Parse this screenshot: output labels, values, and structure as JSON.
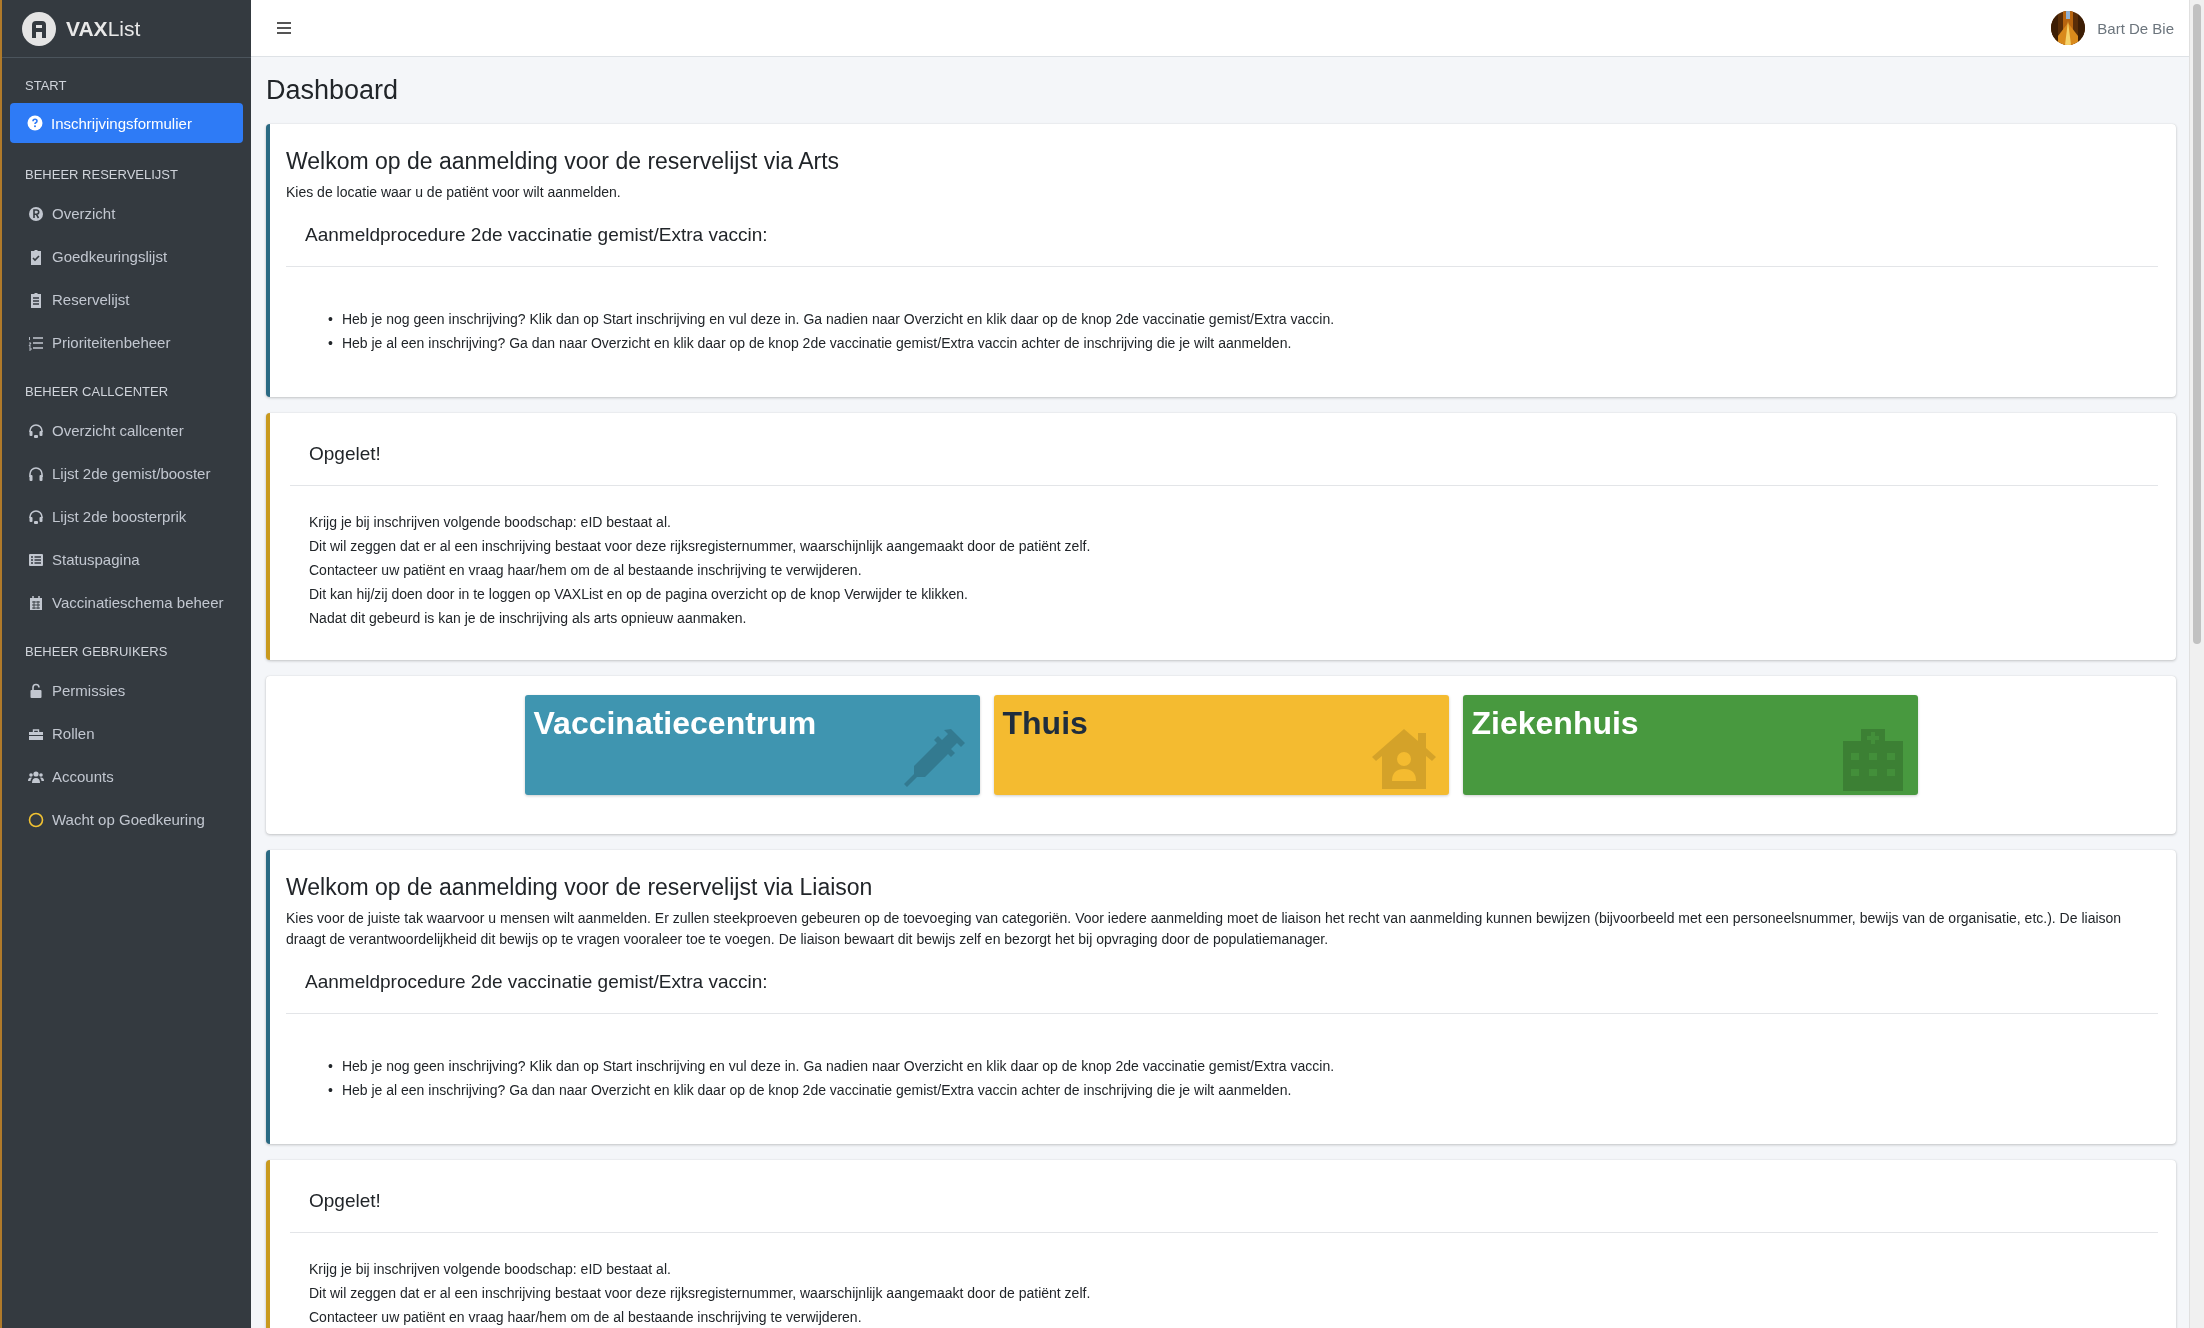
{
  "sidebar": {
    "brand": "**VAX**List",
    "sections": [
      {
        "header": "START",
        "items": [
          {
            "label": "Inschrijvingsformulier",
            "selected": true
          }
        ]
      },
      {
        "header": "BEHEER RESERVELIJST",
        "items": [
          {
            "label": "Overzicht",
            "selected": false
          },
          {
            "label": "Goedkeuringslijst",
            "selected": false
          },
          {
            "label": "Reservelijst",
            "selected": false
          },
          {
            "label": "Prioriteitenbeheer",
            "selected": false
          }
        ]
      },
      {
        "header": "BEHEER CALLCENTER",
        "items": [
          {
            "label": "Overzicht callcenter",
            "selected": false
          },
          {
            "label": "Lijst 2de gemist/booster",
            "selected": false
          },
          {
            "label": "Lijst 2de boosterprik",
            "selected": false
          },
          {
            "label": "Statuspagina",
            "selected": false
          },
          {
            "label": "Vaccinatieschema beheer",
            "selected": false
          }
        ]
      },
      {
        "header": "BEHEER GEBRUIKERS",
        "items": [
          {
            "label": "Permissies",
            "selected": false
          },
          {
            "label": "Rollen",
            "selected": false
          },
          {
            "label": "Accounts",
            "selected": false
          },
          {
            "label": "Wacht op Goedkeuring",
            "selected": false
          }
        ]
      }
    ]
  },
  "topbar": {
    "user": "Bart De Bie"
  },
  "page_title": "Dashboard",
  "cards": [
    {
      "kind": "info",
      "bullet_marker": "•",
      "title": "Welkom op de aanmelding voor de reservelijst via Arts",
      "intro": "Kies de locatie waar u de patiënt voor wilt aanmelden.",
      "procedure_title": "Aanmeldprocedure 2de vaccinatie gemist/Extra vaccin:",
      "bullets": [
        "Heb je nog geen inschrijving? Klik dan op Start inschrijving en vul deze in. Ga nadien naar Overzicht en klik daar op de knop 2de vaccinatie gemist/Extra vaccin.",
        "Heb je al een inschrijving? Ga dan naar Overzicht en klik daar op de knop 2de vaccinatie gemist/Extra vaccin achter de inschrijving die je wilt aanmelden."
      ]
    },
    {
      "kind": "warning",
      "title": "Opgelet!",
      "lines": [
        "Krijg je bij inschrijven volgende boodschap: eID bestaat al.",
        "Dit wil zeggen dat er al een inschrijving bestaat voor deze rijksregisternummer, waarschijnlijk aangemaakt door de patiënt zelf.",
        "Contacteer uw patiënt en vraag haar/hem om de al bestaande inschrijving te verwijderen.",
        "Dit kan hij/zij doen door in te loggen op VAXList en op de pagina overzicht op de knop Verwijder te klikken.",
        "Nadat dit gebeurd is kan je de inschrijving als arts opnieuw aanmaken."
      ]
    },
    {
      "kind": "tiles",
      "tiles": [
        {
          "label": "Vaccinatiecentrum",
          "color": "#3f95b0"
        },
        {
          "label": "Thuis",
          "color": "#f4bb30"
        },
        {
          "label": "Ziekenhuis",
          "color": "#48993f"
        }
      ]
    },
    {
      "kind": "info",
      "bullet_marker": "•",
      "title": "Welkom op de aanmelding voor de reservelijst via Liaison",
      "intro": "Kies voor de juiste tak waarvoor u mensen wilt aanmelden. Er zullen steekproeven gebeuren op de toevoeging van categoriën. Voor iedere aanmelding moet de liaison het recht van aanmelding kunnen bewijzen (bijvoorbeeld met een personeelsnummer, bewijs van de organisatie, etc.). De liaison draagt de verantwoordelijkheid dit bewijs op te vragen vooraleer toe te voegen. De liaison bewaart dit bewijs zelf en bezorgt het bij opvraging door de populatiemanager.",
      "procedure_title": "Aanmeldprocedure 2de vaccinatie gemist/Extra vaccin:",
      "bullets": [
        "Heb je nog geen inschrijving? Klik dan op Start inschrijving en vul deze in. Ga nadien naar Overzicht en klik daar op de knop 2de vaccinatie gemist/Extra vaccin.",
        "Heb je al een inschrijving? Ga dan naar Overzicht en klik daar op de knop 2de vaccinatie gemist/Extra vaccin achter de inschrijving die je wilt aanmelden."
      ]
    },
    {
      "kind": "warning",
      "title": "Opgelet!",
      "lines": [
        "Krijg je bij inschrijven volgende boodschap: eID bestaat al.",
        "Dit wil zeggen dat er al een inschrijving bestaat voor deze rijksregisternummer, waarschijnlijk aangemaakt door de patiënt zelf.",
        "Contacteer uw patiënt en vraag haar/hem om de al bestaande inschrijving te verwijderen."
      ]
    }
  ]
}
